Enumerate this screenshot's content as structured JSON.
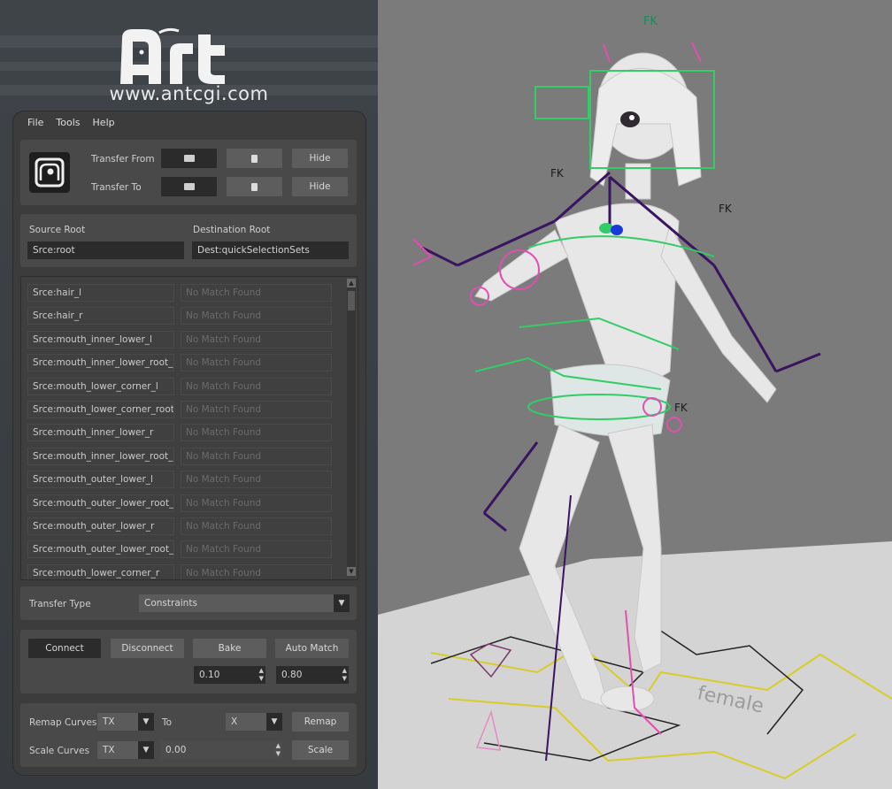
{
  "brand": {
    "url": "www.antcgi.com"
  },
  "menu": [
    "File",
    "Tools",
    "Help"
  ],
  "transfer": {
    "from_label": "Transfer From",
    "to_label": "Transfer To",
    "hide_label": "Hide"
  },
  "roots": {
    "source_label": "Source Root",
    "source_value": "Srce:root",
    "dest_label": "Destination Root",
    "dest_value": "Dest:quickSelectionSets"
  },
  "mapping_rows": [
    {
      "source": "Srce:hair_l",
      "dest": "No Match Found"
    },
    {
      "source": "Srce:hair_r",
      "dest": "No Match Found"
    },
    {
      "source": "Srce:mouth_inner_lower_l",
      "dest": "No Match Found"
    },
    {
      "source": "Srce:mouth_inner_lower_root_l",
      "dest": "No Match Found"
    },
    {
      "source": "Srce:mouth_lower_corner_l",
      "dest": "No Match Found"
    },
    {
      "source": "Srce:mouth_lower_corner_root_l",
      "dest": "No Match Found"
    },
    {
      "source": "Srce:mouth_inner_lower_r",
      "dest": "No Match Found"
    },
    {
      "source": "Srce:mouth_inner_lower_root_r",
      "dest": "No Match Found"
    },
    {
      "source": "Srce:mouth_outer_lower_l",
      "dest": "No Match Found"
    },
    {
      "source": "Srce:mouth_outer_lower_root_l",
      "dest": "No Match Found"
    },
    {
      "source": "Srce:mouth_outer_lower_r",
      "dest": "No Match Found"
    },
    {
      "source": "Srce:mouth_outer_lower_root_r",
      "dest": "No Match Found"
    },
    {
      "source": "Srce:mouth_lower_corner_r",
      "dest": "No Match Found"
    }
  ],
  "transfer_type": {
    "label": "Transfer Type",
    "value": "Constraints"
  },
  "actions": {
    "connect": "Connect",
    "disconnect": "Disconnect",
    "bake": "Bake",
    "auto_match": "Auto Match",
    "bake_value": "0.10",
    "match_value": "0.80"
  },
  "remap": {
    "remap_label": "Remap Curves",
    "from_value": "TX",
    "to_label": "To",
    "to_value": "X",
    "remap_button": "Remap",
    "scale_label": "Scale Curves",
    "scale_channel": "TX",
    "scale_value": "0.00",
    "scale_button": "Scale"
  },
  "viewport": {
    "ground_text": "female",
    "control_label": "FK"
  },
  "colors": {
    "panel": "#3c3c3c",
    "group": "#494949",
    "field": "#2b2b2b",
    "control_green": "#33cc66",
    "control_pink": "#e050b0",
    "bone_purple": "#3a1460",
    "ground_yellow": "#d8cc2a"
  }
}
